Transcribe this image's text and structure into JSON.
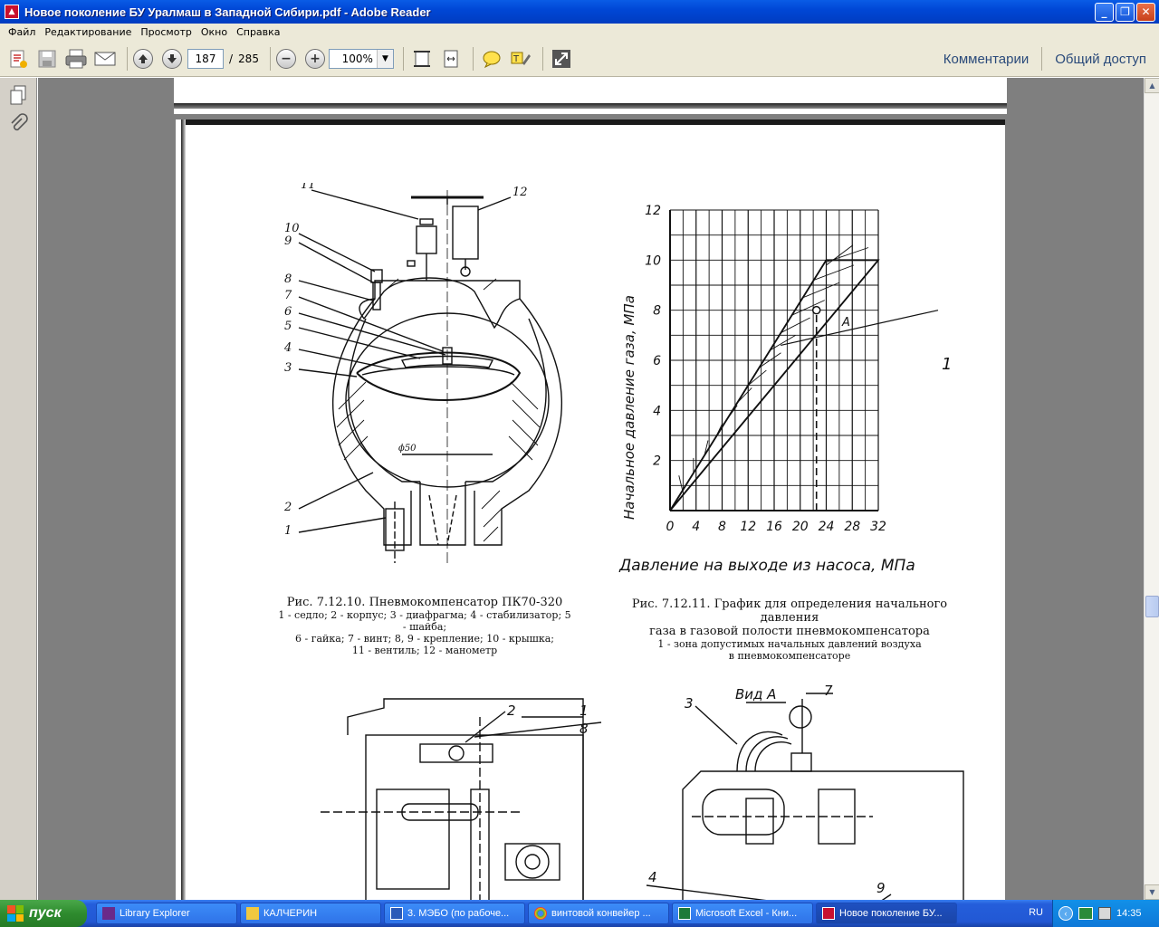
{
  "window": {
    "title": "Новое поколение БУ Уралмаш в Западной Сибири.pdf - Adobe Reader"
  },
  "menu": [
    "Файл",
    "Редактирование",
    "Просмотр",
    "Окно",
    "Справка"
  ],
  "toolbar": {
    "page_current": "187",
    "page_separator": "/",
    "page_total": "285",
    "zoom": "100%",
    "comments": "Комментарии",
    "share": "Общий доступ"
  },
  "document": {
    "fig1": {
      "title": "Рис. 7.12.10. Пневмокомпенсатор ПК70-320",
      "lines": [
        "1 - седло; 2 - корпус; 3 - диафрагма; 4 - стабилизатор; 5 - шайба;",
        "6 - гайка; 7 - винт; 8, 9 - крепление; 10 - крышка;",
        "11 - вентиль; 12 - манометр"
      ],
      "callouts": [
        "11",
        "12",
        "10",
        "9",
        "8",
        "7",
        "6",
        "5",
        "4",
        "3",
        "2",
        "1"
      ],
      "dim": "ϕ50"
    },
    "fig2": {
      "title": "Рис. 7.12.11. График для определения начального давления",
      "lines": [
        "газа в газовой полости пневмокомпенсатора",
        "1 - зона допустимых начальных давлений воздуха",
        "в пневмокомпенсаторе"
      ],
      "marker_A": "A",
      "marker_1": "1"
    },
    "fig3": {
      "view_label": "Вид А",
      "callouts": [
        "2",
        "1",
        "8",
        "3",
        "7",
        "4",
        "9"
      ]
    }
  },
  "chart_data": {
    "type": "line",
    "title": "",
    "xlabel": "Давление на выходе из насоса, МПа",
    "ylabel": "Начальное давление газа, МПа",
    "x_ticks": [
      0,
      4,
      8,
      12,
      16,
      20,
      24,
      28,
      32
    ],
    "y_ticks": [
      2,
      4,
      6,
      8,
      10,
      12
    ],
    "xlim": [
      0,
      32
    ],
    "ylim": [
      0,
      12
    ],
    "grid": true,
    "series": [
      {
        "values": [
          [
            0,
            0
          ],
          [
            24,
            10
          ]
        ]
      },
      {
        "values": [
          [
            0,
            0
          ],
          [
            32,
            10
          ]
        ]
      }
    ],
    "zone_top": [
      [
        24,
        10
      ],
      [
        32,
        10
      ]
    ],
    "point": [
      22.5,
      8
    ],
    "dashed_x": 22.5
  },
  "taskbar": {
    "start": "пуск",
    "tasks": [
      "Library Explorer",
      "КАЛЧЕРИН",
      "3. МЭБО (по рабоче...",
      "винтовой конвейер ...",
      "Microsoft Excel - Кни...",
      "Новое поколение БУ..."
    ],
    "lang": "RU",
    "time": "14:35"
  }
}
